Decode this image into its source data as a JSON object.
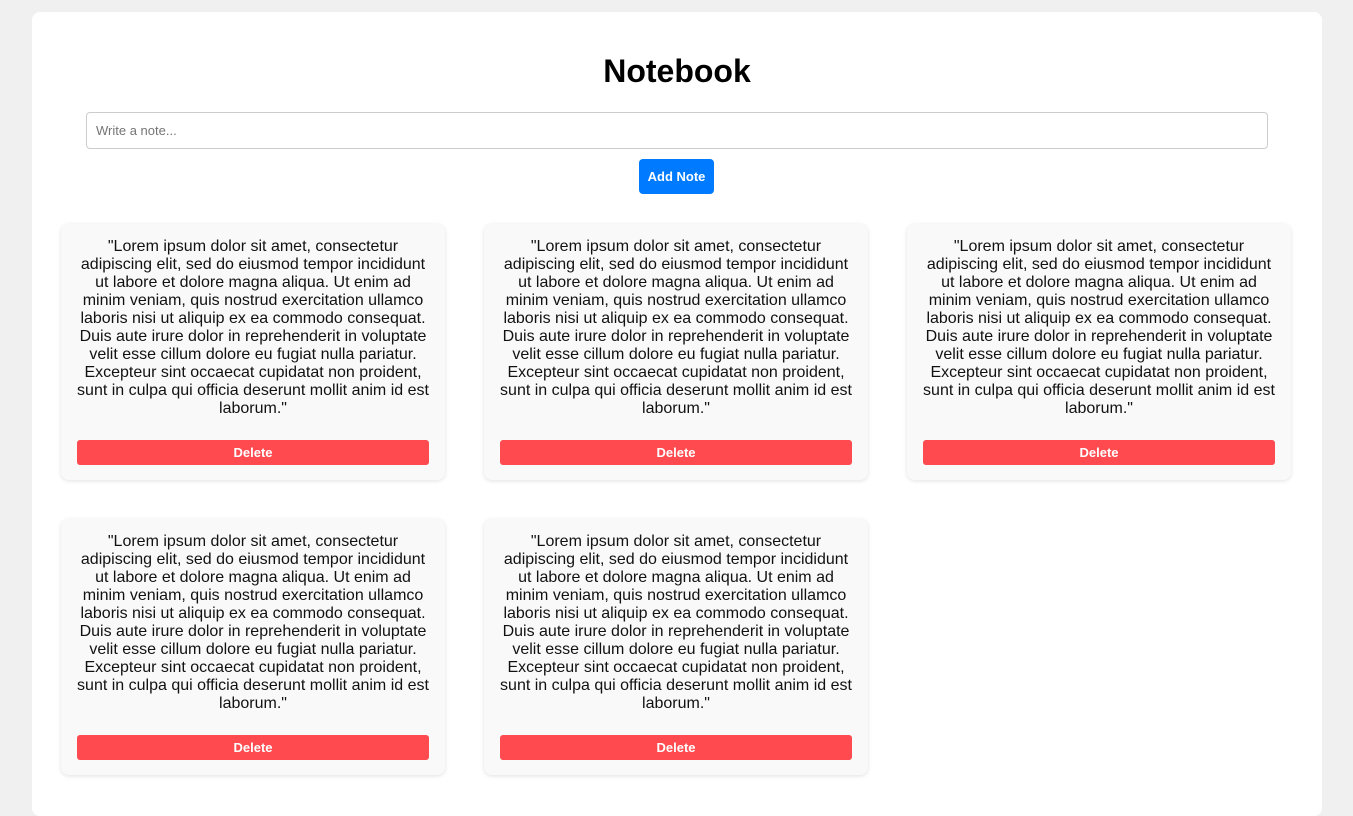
{
  "app": {
    "title": "Notebook"
  },
  "input": {
    "placeholder": "Write a note...",
    "value": ""
  },
  "buttons": {
    "add_label": "Add Note",
    "delete_label": "Delete"
  },
  "colors": {
    "add_button": "#007bff",
    "delete_button": "#ff4a4f",
    "card_background": "#f9f9f9",
    "page_background": "#f0f0f0"
  },
  "notes": [
    {
      "text": "\"Lorem ipsum dolor sit amet, consectetur adipiscing elit, sed do eiusmod tempor incididunt ut labore et dolore magna aliqua. Ut enim ad minim veniam, quis nostrud exercitation ullamco laboris nisi ut aliquip ex ea commodo consequat. Duis aute irure dolor in reprehenderit in voluptate velit esse cillum dolore eu fugiat nulla pariatur. Excepteur sint occaecat cupidatat non proident, sunt in culpa qui officia deserunt mollit anim id est laborum.\"",
      "delete_label": "Delete"
    },
    {
      "text": "\"Lorem ipsum dolor sit amet, consectetur adipiscing elit, sed do eiusmod tempor incididunt ut labore et dolore magna aliqua. Ut enim ad minim veniam, quis nostrud exercitation ullamco laboris nisi ut aliquip ex ea commodo consequat. Duis aute irure dolor in reprehenderit in voluptate velit esse cillum dolore eu fugiat nulla pariatur. Excepteur sint occaecat cupidatat non proident, sunt in culpa qui officia deserunt mollit anim id est laborum.\"",
      "delete_label": "Delete"
    },
    {
      "text": "\"Lorem ipsum dolor sit amet, consectetur adipiscing elit, sed do eiusmod tempor incididunt ut labore et dolore magna aliqua. Ut enim ad minim veniam, quis nostrud exercitation ullamco laboris nisi ut aliquip ex ea commodo consequat. Duis aute irure dolor in reprehenderit in voluptate velit esse cillum dolore eu fugiat nulla pariatur. Excepteur sint occaecat cupidatat non proident, sunt in culpa qui officia deserunt mollit anim id est laborum.\"",
      "delete_label": "Delete"
    },
    {
      "text": "\"Lorem ipsum dolor sit amet, consectetur adipiscing elit, sed do eiusmod tempor incididunt ut labore et dolore magna aliqua. Ut enim ad minim veniam, quis nostrud exercitation ullamco laboris nisi ut aliquip ex ea commodo consequat. Duis aute irure dolor in reprehenderit in voluptate velit esse cillum dolore eu fugiat nulla pariatur. Excepteur sint occaecat cupidatat non proident, sunt in culpa qui officia deserunt mollit anim id est laborum.\"",
      "delete_label": "Delete"
    },
    {
      "text": "\"Lorem ipsum dolor sit amet, consectetur adipiscing elit, sed do eiusmod tempor incididunt ut labore et dolore magna aliqua. Ut enim ad minim veniam, quis nostrud exercitation ullamco laboris nisi ut aliquip ex ea commodo consequat. Duis aute irure dolor in reprehenderit in voluptate velit esse cillum dolore eu fugiat nulla pariatur. Excepteur sint occaecat cupidatat non proident, sunt in culpa qui officia deserunt mollit anim id est laborum.\"",
      "delete_label": "Delete"
    }
  ]
}
